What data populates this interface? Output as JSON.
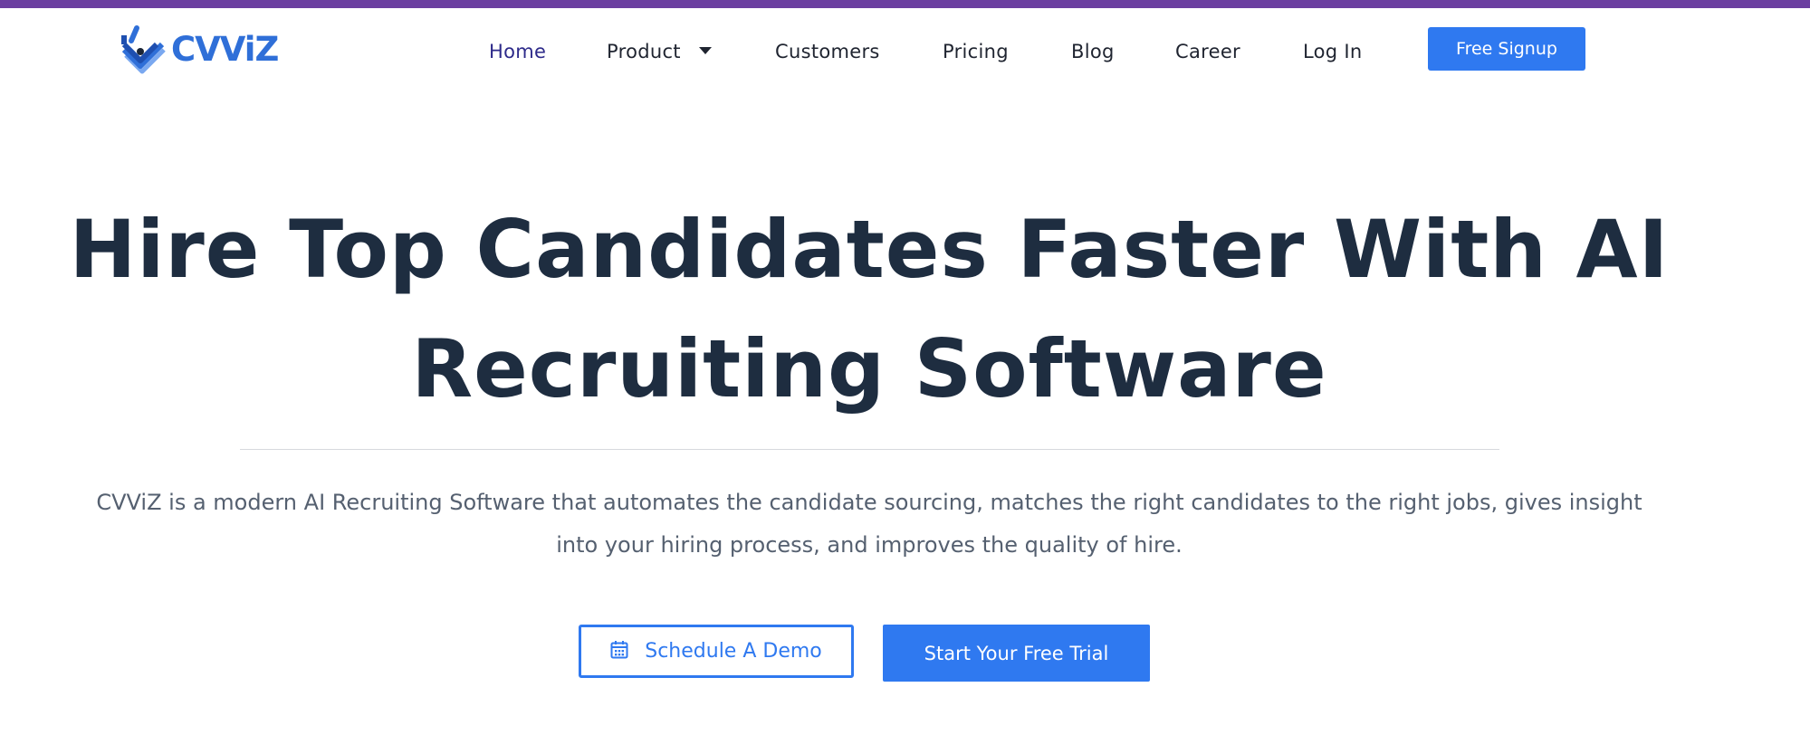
{
  "brand": {
    "name": "CVViZ",
    "top_bar_color": "#6b3fa0",
    "accent_color": "#2f79f0"
  },
  "nav": {
    "items": [
      {
        "label": "Home",
        "active": true
      },
      {
        "label": "Product",
        "has_dropdown": true
      },
      {
        "label": "Customers"
      },
      {
        "label": "Pricing"
      },
      {
        "label": "Blog"
      },
      {
        "label": "Career"
      },
      {
        "label": "Log In"
      }
    ],
    "signup_label": "Free Signup"
  },
  "hero": {
    "title_line1": "Hire Top Candidates Faster With AI",
    "title_line2": "Recruiting Software",
    "description_line1": "CVViZ is a modern AI Recruiting Software that automates the candidate sourcing, matches the right candidates to the right jobs, gives insight",
    "description_line2": "into your hiring process, and improves the quality of hire.",
    "demo_button_label": "Schedule A Demo",
    "demo_button_icon": "calendar-icon",
    "trial_button_label": "Start Your Free Trial"
  }
}
